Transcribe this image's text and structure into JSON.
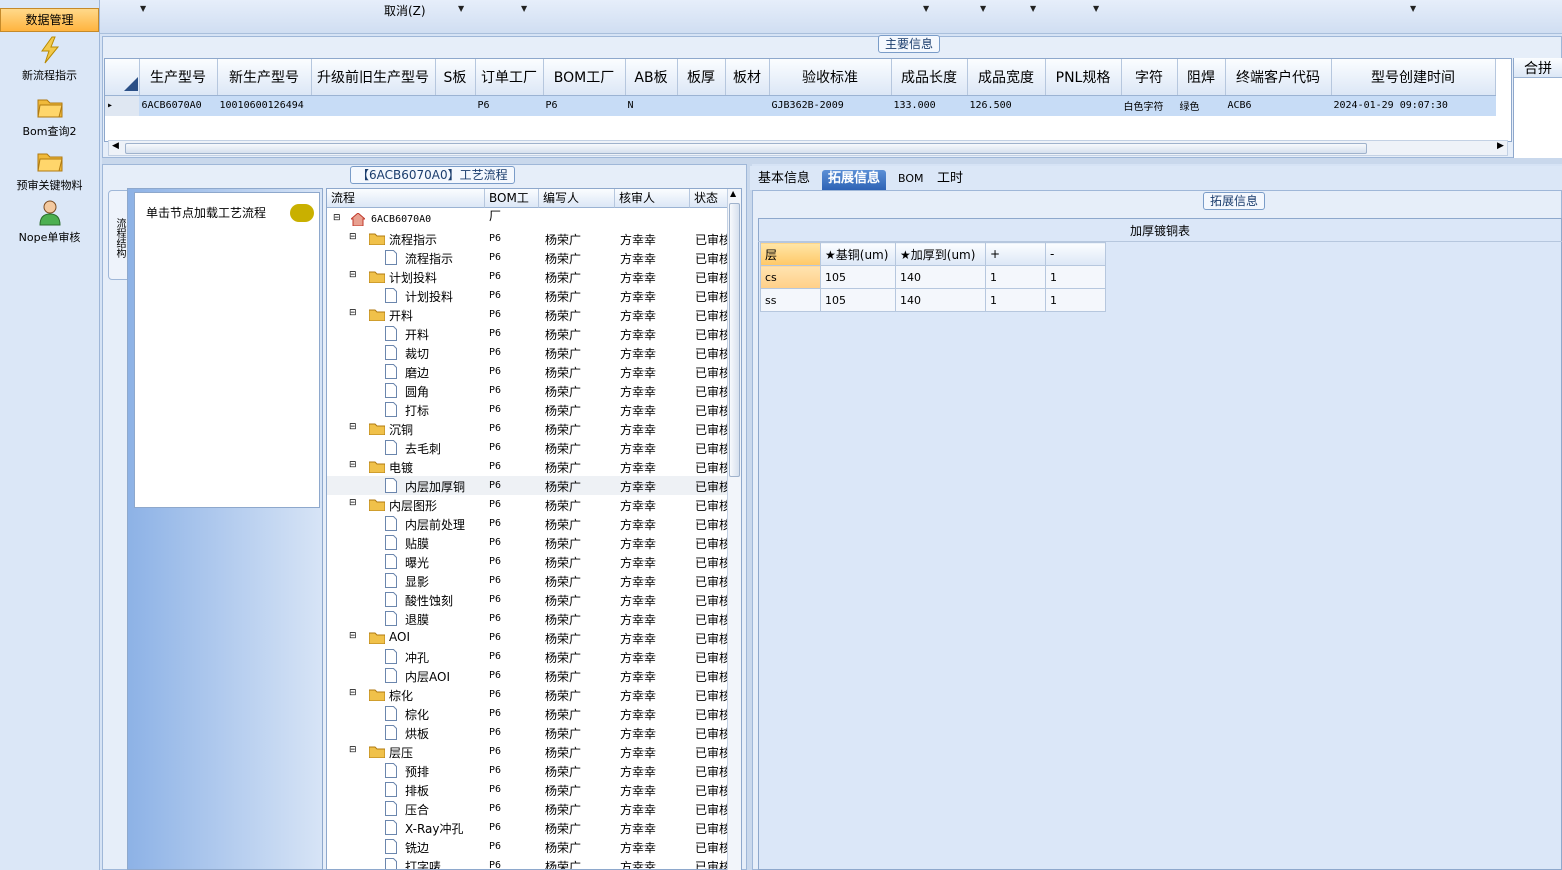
{
  "nav": {
    "active": "数据管理",
    "items": [
      {
        "label": "新流程指示",
        "icon": "lightning-icon"
      },
      {
        "label": "Bom查询2",
        "icon": "folder-icon"
      },
      {
        "label": "预审关键物料",
        "icon": "folder-icon"
      },
      {
        "label": "Nope单审核",
        "icon": "user-icon"
      }
    ]
  },
  "toolbar": {
    "cancel_label": "取消(Z)"
  },
  "main_info": {
    "title": "主要信息",
    "columns": [
      "生产型号",
      "新生产型号",
      "升级前旧生产型号",
      "S板",
      "订单工厂",
      "BOM工厂",
      "AB板",
      "板厚",
      "板材",
      "验收标准",
      "成品长度",
      "成品宽度",
      "PNL规格",
      "字符",
      "阻焊",
      "终端客户代码",
      "型号创建时间"
    ],
    "row": [
      "6ACB6070A0",
      "10010600126494",
      "",
      "",
      "P6",
      "P6",
      "N",
      "",
      "",
      "GJB362B-2009",
      "133.000",
      "126.500",
      "",
      "白色字符",
      "绿色",
      "ACB6",
      "2024-01-29 09:07:30"
    ],
    "extra_column": "合拼"
  },
  "process": {
    "title": "【6ACB6070A0】工艺流程",
    "side_tab": "流程结构",
    "hint": "单击节点加载工艺流程",
    "columns": [
      "流程",
      "BOM工厂",
      "编写人",
      "核审人",
      "状态"
    ],
    "root": "6ACB6070A0",
    "rows": [
      {
        "level": 1,
        "name": "流程指示"
      },
      {
        "level": 2,
        "name": "流程指示"
      },
      {
        "level": 1,
        "name": "计划投料"
      },
      {
        "level": 2,
        "name": "计划投料"
      },
      {
        "level": 1,
        "name": "开料"
      },
      {
        "level": 2,
        "name": "开料"
      },
      {
        "level": 2,
        "name": "裁切"
      },
      {
        "level": 2,
        "name": "磨边"
      },
      {
        "level": 2,
        "name": "圆角"
      },
      {
        "level": 2,
        "name": "打标"
      },
      {
        "level": 1,
        "name": "沉铜"
      },
      {
        "level": 2,
        "name": "去毛刺"
      },
      {
        "level": 1,
        "name": "电镀"
      },
      {
        "level": 2,
        "name": "内层加厚铜"
      },
      {
        "level": 1,
        "name": "内层图形"
      },
      {
        "level": 2,
        "name": "内层前处理"
      },
      {
        "level": 2,
        "name": "贴膜"
      },
      {
        "level": 2,
        "name": "曝光"
      },
      {
        "level": 2,
        "name": "显影"
      },
      {
        "level": 2,
        "name": "酸性蚀刻"
      },
      {
        "level": 2,
        "name": "退膜"
      },
      {
        "level": 1,
        "name": "AOI"
      },
      {
        "level": 2,
        "name": "冲孔"
      },
      {
        "level": 2,
        "name": "内层AOI"
      },
      {
        "level": 1,
        "name": "棕化"
      },
      {
        "level": 2,
        "name": "棕化"
      },
      {
        "level": 2,
        "name": "烘板"
      },
      {
        "level": 1,
        "name": "层压"
      },
      {
        "level": 2,
        "name": "预排"
      },
      {
        "level": 2,
        "name": "排板"
      },
      {
        "level": 2,
        "name": "压合"
      },
      {
        "level": 2,
        "name": "X-Ray冲孔"
      },
      {
        "level": 2,
        "name": "铣边"
      },
      {
        "level": 2,
        "name": "打字唛"
      }
    ],
    "factory": "P6",
    "writer": "杨荣广",
    "reviewer": "方幸幸",
    "status": "已审核"
  },
  "tabs": [
    "基本信息",
    "拓展信息",
    "BOM",
    "工时"
  ],
  "active_tab": "拓展信息",
  "ext": {
    "title": "拓展信息",
    "table_title": "加厚镀铜表",
    "columns": [
      "层",
      "★基铜(um)",
      "★加厚到(um)",
      "+",
      "-"
    ],
    "rows": [
      [
        "cs",
        "105",
        "140",
        "1",
        "1"
      ],
      [
        "ss",
        "105",
        "140",
        "1",
        "1"
      ]
    ]
  }
}
